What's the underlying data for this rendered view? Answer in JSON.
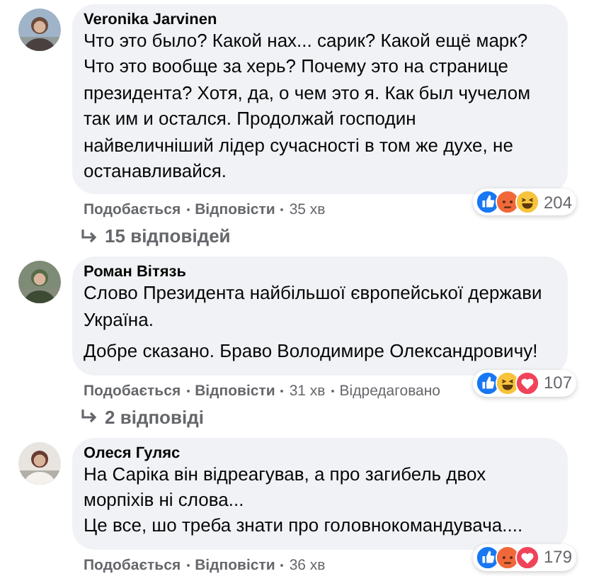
{
  "comments": [
    {
      "author": "Veronika Jarvinen",
      "paragraphs": [
        "Что это было? Какой нах... сарик? Какой ещё марк? Что это вообще за херь? Почему это на странице президента? Хотя, да, о чем это я. Как был чучелом так им и остался. Продолжай господин найвеличніший лідер сучасності в том же духе, не останавливайся."
      ],
      "reactions": [
        {
          "kind": "like"
        },
        {
          "kind": "angry"
        },
        {
          "kind": "haha"
        }
      ],
      "reaction_count": "204",
      "like_label": "Подобається",
      "reply_label": "Відповісти",
      "time": "35 хв",
      "replies_link": "15 відповідей"
    },
    {
      "author": "Роман Вітязь",
      "paragraphs": [
        "Слово Президента найбільшої європейської держави Україна.",
        "Добре сказано. Браво Володимире Олександровичу!"
      ],
      "reactions": [
        {
          "kind": "like"
        },
        {
          "kind": "haha"
        },
        {
          "kind": "love"
        }
      ],
      "reaction_count": "107",
      "like_label": "Подобається",
      "reply_label": "Відповісти",
      "time": "31 хв",
      "edited": "Відредаговано",
      "replies_link": "2 відповіді"
    },
    {
      "author": "Олеся Гуляс",
      "paragraphs": [
        "На Саріка він відреагував, а про загибель двох морпіхів ні слова...",
        "Це все, шо треба знати про головнокомандувача...."
      ],
      "reactions": [
        {
          "kind": "like"
        },
        {
          "kind": "angry"
        },
        {
          "kind": "love"
        }
      ],
      "reaction_count": "179",
      "like_label": "Подобається",
      "reply_label": "Відповісти",
      "time": "36 хв"
    }
  ]
}
